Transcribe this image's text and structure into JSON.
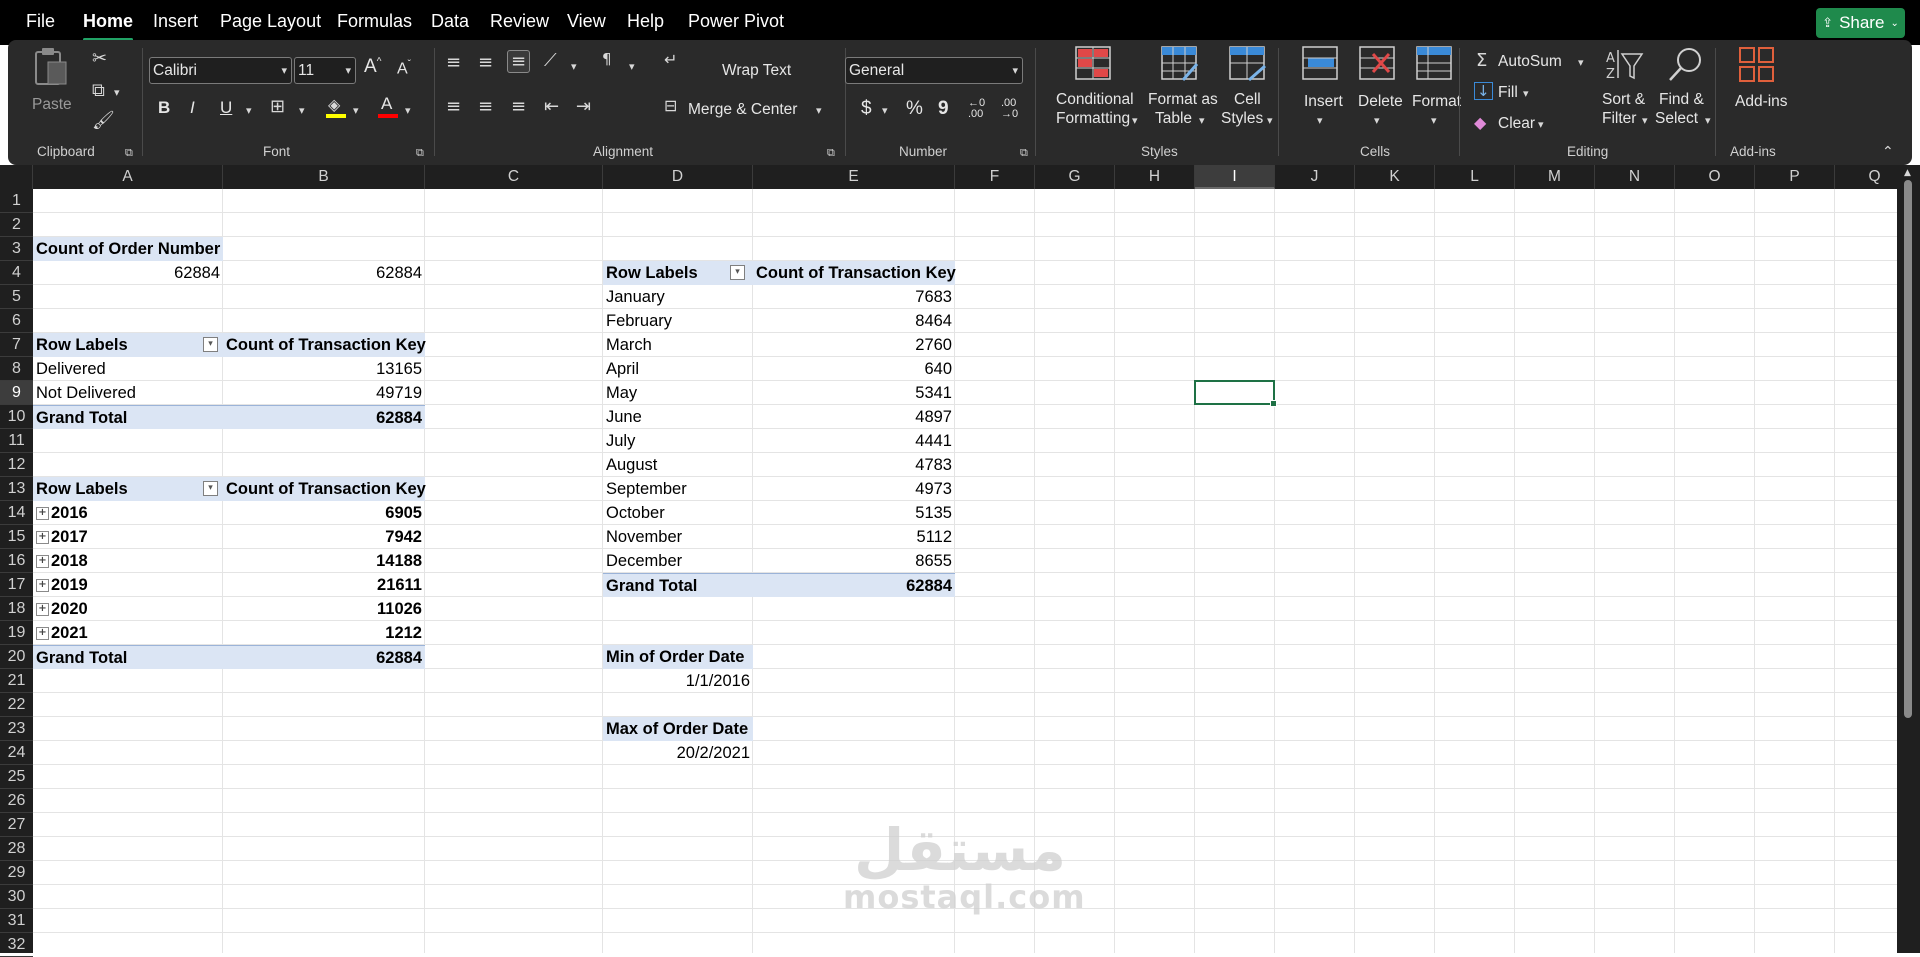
{
  "menu": {
    "tabs": [
      "File",
      "Home",
      "Insert",
      "Page Layout",
      "Formulas",
      "Data",
      "Review",
      "View",
      "Help",
      "Power Pivot"
    ],
    "active": "Home",
    "share_label": "Share"
  },
  "ribbon": {
    "clipboard": {
      "paste": "Paste",
      "group": "Clipboard"
    },
    "font": {
      "name": "Calibri",
      "size": "11",
      "bold": "B",
      "italic": "I",
      "underline": "U",
      "group": "Font"
    },
    "alignment": {
      "wrap": "Wrap Text",
      "merge": "Merge & Center",
      "group": "Alignment"
    },
    "number": {
      "format": "General",
      "currency": "$",
      "percent": "%",
      "comma": "9",
      "group": "Number"
    },
    "styles": {
      "conditional_1": "Conditional",
      "conditional_2": "Formatting",
      "table_1": "Format as",
      "table_2": "Table",
      "cell_1": "Cell",
      "cell_2": "Styles",
      "group": "Styles"
    },
    "cells": {
      "insert": "Insert",
      "delete": "Delete",
      "format": "Format",
      "group": "Cells"
    },
    "editing": {
      "autosum": "AutoSum",
      "fill": "Fill",
      "clear": "Clear",
      "sort_1": "Sort &",
      "sort_2": "Filter",
      "find_1": "Find &",
      "find_2": "Select",
      "group": "Editing"
    },
    "addins": {
      "label": "Add-ins",
      "group": "Add-ins"
    }
  },
  "columns": [
    "A",
    "B",
    "C",
    "D",
    "E",
    "F",
    "G",
    "H",
    "I",
    "J",
    "K",
    "L",
    "M",
    "N",
    "O",
    "P",
    "Q"
  ],
  "selected_column": "I",
  "rows": [
    "1",
    "2",
    "3",
    "4",
    "5",
    "6",
    "7",
    "8",
    "9",
    "10",
    "11",
    "12",
    "13",
    "14",
    "15",
    "16",
    "17",
    "18",
    "19",
    "20",
    "21",
    "22",
    "23",
    "24",
    "25",
    "26",
    "27",
    "28",
    "29",
    "30",
    "31",
    "32"
  ],
  "pivot_orders": {
    "header": "Count of Order Number",
    "a_value": "62884",
    "b_value": "62884"
  },
  "pivot_status": {
    "row_labels": "Row Labels",
    "count_header": "Count of Transaction Key",
    "rows": [
      {
        "label": "Delivered",
        "value": "13165"
      },
      {
        "label": "Not Delivered",
        "value": "49719"
      }
    ],
    "total_label": "Grand Total",
    "total_value": "62884"
  },
  "pivot_years": {
    "row_labels": "Row Labels",
    "count_header": "Count of Transaction Key",
    "rows": [
      {
        "label": "2016",
        "value": "6905"
      },
      {
        "label": "2017",
        "value": "7942"
      },
      {
        "label": "2018",
        "value": "14188"
      },
      {
        "label": "2019",
        "value": "21611"
      },
      {
        "label": "2020",
        "value": "11026"
      },
      {
        "label": "2021",
        "value": "1212"
      }
    ],
    "total_label": "Grand Total",
    "total_value": "62884"
  },
  "pivot_months": {
    "row_labels": "Row Labels",
    "count_header": "Count of Transaction Key",
    "rows": [
      {
        "label": "January",
        "value": "7683"
      },
      {
        "label": "February",
        "value": "8464"
      },
      {
        "label": "March",
        "value": "2760"
      },
      {
        "label": "April",
        "value": "640"
      },
      {
        "label": "May",
        "value": "5341"
      },
      {
        "label": "June",
        "value": "4897"
      },
      {
        "label": "July",
        "value": "4441"
      },
      {
        "label": "August",
        "value": "4783"
      },
      {
        "label": "September",
        "value": "4973"
      },
      {
        "label": "October",
        "value": "5135"
      },
      {
        "label": "November",
        "value": "5112"
      },
      {
        "label": "December",
        "value": "8655"
      }
    ],
    "total_label": "Grand Total",
    "total_value": "62884"
  },
  "min_date": {
    "header": "Min of Order Date",
    "value": "1/1/2016"
  },
  "max_date": {
    "header": "Max of Order Date",
    "value": "20/2/2021"
  },
  "watermark": {
    "arabic": "مستقل",
    "latin": "mostaql.com"
  },
  "colors": {
    "accent": "#21a366",
    "pivot_header": "#dbe5f4",
    "ribbon_bg": "#2a2a2a"
  }
}
